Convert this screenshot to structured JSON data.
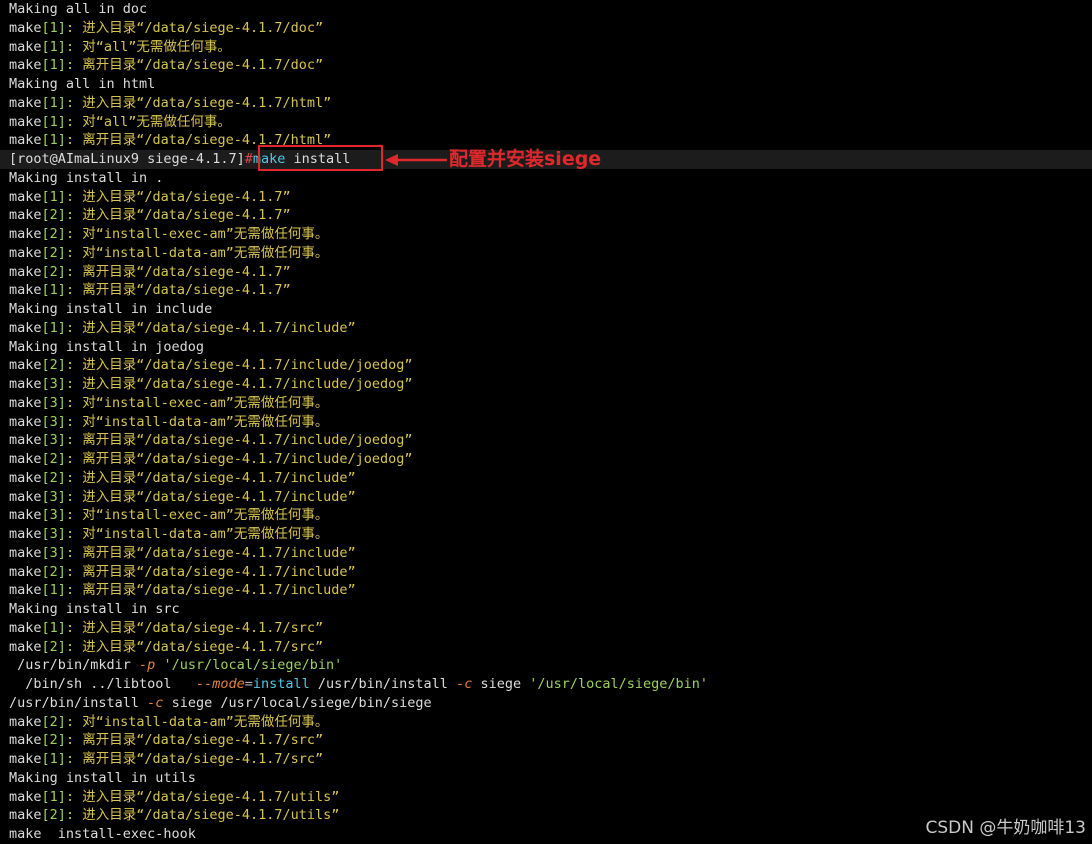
{
  "terminal": {
    "lines": [
      {
        "kind": "plain",
        "text": "Making all in doc"
      },
      {
        "kind": "make",
        "level": "1",
        "msg": "进入目录“/data/siege-4.1.7/doc”"
      },
      {
        "kind": "make",
        "level": "1",
        "msg": "对“all”无需做任何事。"
      },
      {
        "kind": "make",
        "level": "1",
        "msg": "离开目录“/data/siege-4.1.7/doc”"
      },
      {
        "kind": "plain",
        "text": "Making all in html"
      },
      {
        "kind": "make",
        "level": "1",
        "msg": "进入目录“/data/siege-4.1.7/html”"
      },
      {
        "kind": "make",
        "level": "1",
        "msg": "对“all”无需做任何事。"
      },
      {
        "kind": "make",
        "level": "1",
        "msg": "离开目录“/data/siege-4.1.7/html”"
      },
      {
        "kind": "prompt",
        "prompt": "[root@AImaLinux9 siege-4.1.7]",
        "symbol": "#",
        "cmd": "make",
        "args": " install"
      },
      {
        "kind": "plain",
        "text": "Making install in ."
      },
      {
        "kind": "make",
        "level": "1",
        "msg": "进入目录“/data/siege-4.1.7”"
      },
      {
        "kind": "make",
        "level": "2",
        "msg": "进入目录“/data/siege-4.1.7”"
      },
      {
        "kind": "make",
        "level": "2",
        "msg": "对“install-exec-am”无需做任何事。"
      },
      {
        "kind": "make",
        "level": "2",
        "msg": "对“install-data-am”无需做任何事。"
      },
      {
        "kind": "make",
        "level": "2",
        "msg": "离开目录“/data/siege-4.1.7”"
      },
      {
        "kind": "make",
        "level": "1",
        "msg": "离开目录“/data/siege-4.1.7”"
      },
      {
        "kind": "plain",
        "text": "Making install in include"
      },
      {
        "kind": "make",
        "level": "1",
        "msg": "进入目录“/data/siege-4.1.7/include”"
      },
      {
        "kind": "plain",
        "text": "Making install in joedog"
      },
      {
        "kind": "make",
        "level": "2",
        "msg": "进入目录“/data/siege-4.1.7/include/joedog”"
      },
      {
        "kind": "make",
        "level": "3",
        "msg": "进入目录“/data/siege-4.1.7/include/joedog”"
      },
      {
        "kind": "make",
        "level": "3",
        "msg": "对“install-exec-am”无需做任何事。"
      },
      {
        "kind": "make",
        "level": "3",
        "msg": "对“install-data-am”无需做任何事。"
      },
      {
        "kind": "make",
        "level": "3",
        "msg": "离开目录“/data/siege-4.1.7/include/joedog”"
      },
      {
        "kind": "make",
        "level": "2",
        "msg": "离开目录“/data/siege-4.1.7/include/joedog”"
      },
      {
        "kind": "make",
        "level": "2",
        "msg": "进入目录“/data/siege-4.1.7/include”"
      },
      {
        "kind": "make",
        "level": "3",
        "msg": "进入目录“/data/siege-4.1.7/include”"
      },
      {
        "kind": "make",
        "level": "3",
        "msg": "对“install-exec-am”无需做任何事。"
      },
      {
        "kind": "make",
        "level": "3",
        "msg": "对“install-data-am”无需做任何事。"
      },
      {
        "kind": "make",
        "level": "3",
        "msg": "离开目录“/data/siege-4.1.7/include”"
      },
      {
        "kind": "make",
        "level": "2",
        "msg": "离开目录“/data/siege-4.1.7/include”"
      },
      {
        "kind": "make",
        "level": "1",
        "msg": "离开目录“/data/siege-4.1.7/include”"
      },
      {
        "kind": "plain",
        "text": "Making install in src"
      },
      {
        "kind": "make",
        "level": "1",
        "msg": "进入目录“/data/siege-4.1.7/src”"
      },
      {
        "kind": "make",
        "level": "2",
        "msg": "进入目录“/data/siege-4.1.7/src”"
      },
      {
        "kind": "rich",
        "segments": [
          {
            "t": " /usr/bin/mkdir ",
            "c": "white"
          },
          {
            "t": "-p",
            "c": "orange",
            "i": true
          },
          {
            "t": " ",
            "c": "white"
          },
          {
            "t": "'/usr/local/siege/bin'",
            "c": "green"
          }
        ]
      },
      {
        "kind": "rich",
        "segments": [
          {
            "t": "  /bin/sh ../libtool   ",
            "c": "white"
          },
          {
            "t": "--mode",
            "c": "orange",
            "i": true
          },
          {
            "t": "=",
            "c": "gray"
          },
          {
            "t": "install",
            "c": "cyan"
          },
          {
            "t": " /usr/bin/install ",
            "c": "white"
          },
          {
            "t": "-c",
            "c": "orange",
            "i": true
          },
          {
            "t": " siege ",
            "c": "white"
          },
          {
            "t": "'/usr/local/siege/bin'",
            "c": "green"
          }
        ]
      },
      {
        "kind": "rich",
        "segments": [
          {
            "t": "/usr/bin/install ",
            "c": "white"
          },
          {
            "t": "-c",
            "c": "orange",
            "i": true
          },
          {
            "t": " siege /usr/local/siege/bin/siege",
            "c": "white"
          }
        ]
      },
      {
        "kind": "make",
        "level": "2",
        "msg": "对“install-data-am”无需做任何事。"
      },
      {
        "kind": "make",
        "level": "2",
        "msg": "离开目录“/data/siege-4.1.7/src”"
      },
      {
        "kind": "make",
        "level": "1",
        "msg": "离开目录“/data/siege-4.1.7/src”"
      },
      {
        "kind": "plain",
        "text": "Making install in utils"
      },
      {
        "kind": "make",
        "level": "1",
        "msg": "进入目录“/data/siege-4.1.7/utils”"
      },
      {
        "kind": "make",
        "level": "2",
        "msg": "进入目录“/data/siege-4.1.7/utils”"
      },
      {
        "kind": "plain",
        "text": "make  install-exec-hook"
      }
    ]
  },
  "annotation": {
    "text": "配置并安装siege",
    "color": "#e0282c"
  },
  "watermark": {
    "text": "CSDN @牛奶咖啡13"
  },
  "colors": {
    "background": "#000000",
    "text": "#dcdcdc",
    "make_bracket_number": "#9bd25b",
    "make_message": "#d8c34e",
    "command": "#4ec9e6",
    "flag": "#e0823a",
    "string": "#9bd25b",
    "prompt_symbol": "#e0454a"
  }
}
